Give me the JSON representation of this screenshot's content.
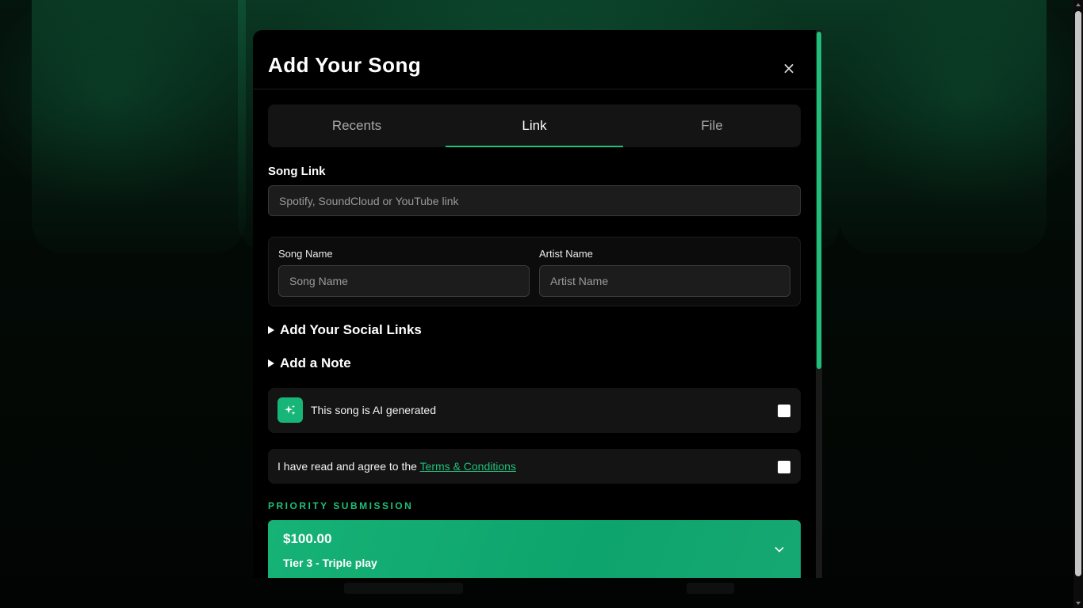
{
  "modal": {
    "title": "Add Your Song",
    "close_label": "×"
  },
  "tabs": [
    {
      "label": "Recents",
      "active": false
    },
    {
      "label": "Link",
      "active": true
    },
    {
      "label": "File",
      "active": false
    }
  ],
  "song_link": {
    "label": "Song Link",
    "placeholder": "Spotify, SoundCloud or YouTube link",
    "value": ""
  },
  "song_name": {
    "label": "Song Name",
    "placeholder": "Song Name",
    "value": ""
  },
  "artist_name": {
    "label": "Artist Name",
    "placeholder": "Artist Name",
    "value": ""
  },
  "sections": {
    "social_links": "Add Your Social Links",
    "note": "Add a Note"
  },
  "ai_generated": {
    "label": "This song is AI generated",
    "icon": "sparkle-icon",
    "checked": false
  },
  "terms": {
    "prefix": "I have read and agree to the ",
    "link_text": "Terms & Conditions",
    "checked": false
  },
  "priority": {
    "heading": "PRIORITY SUBMISSION",
    "price": "$100.00",
    "tier": "Tier 3 - Triple play"
  },
  "colors": {
    "accent": "#1fbf7a",
    "modal_bg": "#000000",
    "surface": "#141414"
  }
}
